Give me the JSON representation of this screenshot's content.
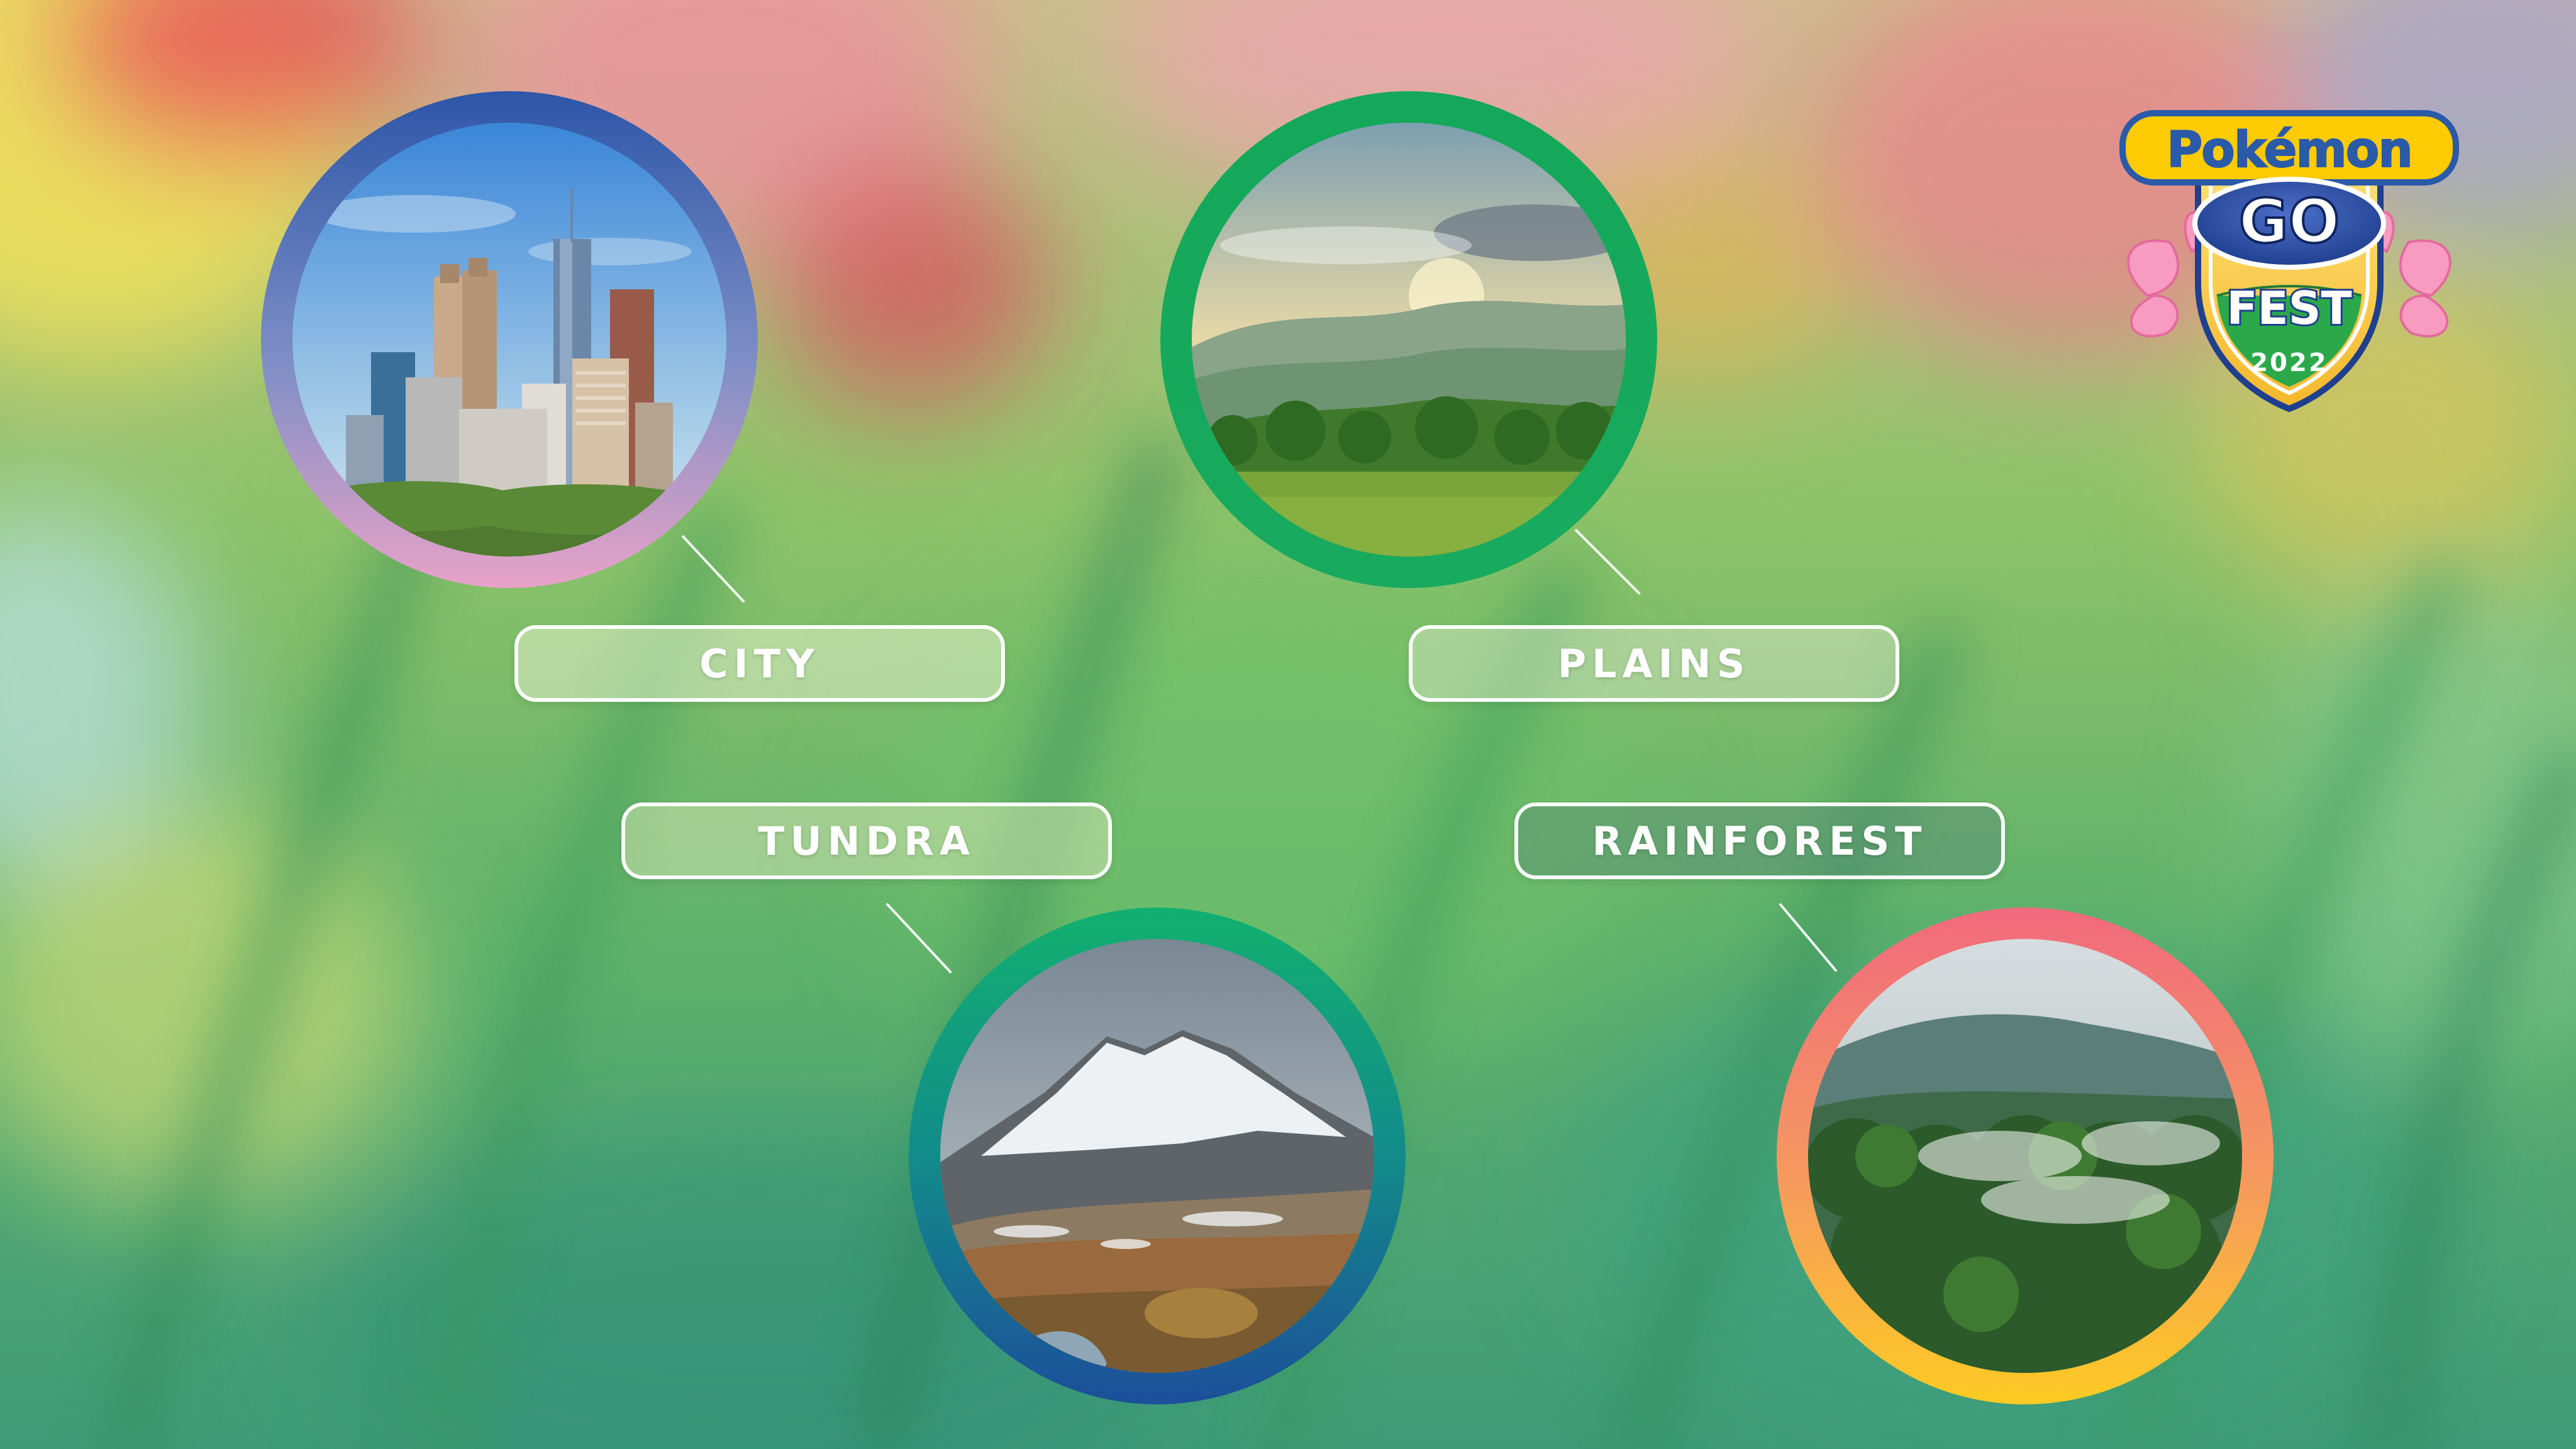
{
  "logo": {
    "brand": "Pokémon",
    "brand_word": "GO",
    "event": "FEST",
    "year": "2022"
  },
  "habitats": [
    {
      "id": "city",
      "label": "CITY",
      "scene": "city-skyline",
      "ring_colors": [
        "#2d56a8",
        "#7f8fc6",
        "#e8a2c8"
      ]
    },
    {
      "id": "plains",
      "label": "PLAINS",
      "scene": "green-plains",
      "ring_colors": [
        "#14a85a",
        "#1cb76a",
        "#18aa5e"
      ]
    },
    {
      "id": "tundra",
      "label": "TUNDRA",
      "scene": "snowy-mountain",
      "ring_colors": [
        "#12b070",
        "#128c8a",
        "#1c4f9a"
      ]
    },
    {
      "id": "rainforest",
      "label": "RAINFOREST",
      "scene": "misty-rainforest",
      "ring_colors": [
        "#f16a7e",
        "#f59a5e",
        "#ffcb22"
      ]
    }
  ]
}
